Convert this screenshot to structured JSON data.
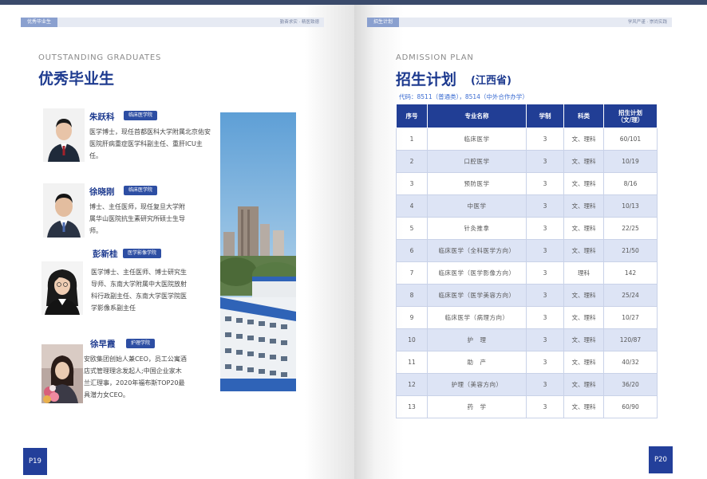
{
  "left": {
    "header_tag": "优秀毕业生",
    "header_right": "勤奋求实 · 精医致德",
    "title_en": "OUTSTANDING GRADUATES",
    "title_cn": "优秀毕业生",
    "page_number": "P19",
    "graduates": [
      {
        "name": "朱跃科",
        "college": "临床医学院",
        "description": "医学博士，现任首都医科大学附属北京佑安医院肝病重症医学科副主任、重肝ICU主任。"
      },
      {
        "name": "徐晓刚",
        "college": "临床医学院",
        "description": "博士、主任医师，现任复旦大学附属华山医院抗生素研究所硕士生导师。"
      },
      {
        "name": "彭新桂",
        "college": "医学影像学院",
        "description": "医学博士、主任医师、博士研究生导师、东南大学附属中大医院放射科行政副主任、东南大学医学院医学影像系副主任"
      },
      {
        "name": "徐早霞",
        "college": "护理学院",
        "description": "安欧集团创始人兼CEO，员工公寓酒店式管理理念发起人;中国企业家木兰汇理事，2020年福布斯TOP20最具潜力女CEO。"
      }
    ]
  },
  "right": {
    "header_tag": "招生计划",
    "header_right": "学风严谨 · 崇尚实践",
    "title_en": "ADMISSION PLAN",
    "title_cn": "招生计划",
    "province": "(江西省)",
    "code_line": "代码：8511（普通类），8514（中外合作办学）",
    "page_number": "P20",
    "table": {
      "headers": [
        "序号",
        "专业名称",
        "学制",
        "科类",
        "招生计划\n（文/理）"
      ],
      "rows": [
        [
          "1",
          "临床医学",
          "3",
          "文、理科",
          "60/101"
        ],
        [
          "2",
          "口腔医学",
          "3",
          "文、理科",
          "10/19"
        ],
        [
          "3",
          "预防医学",
          "3",
          "文、理科",
          "8/16"
        ],
        [
          "4",
          "中医学",
          "3",
          "文、理科",
          "10/13"
        ],
        [
          "5",
          "针灸推拿",
          "3",
          "文、理科",
          "22/25"
        ],
        [
          "6",
          "临床医学（全科医学方向）",
          "3",
          "文、理科",
          "21/50"
        ],
        [
          "7",
          "临床医学（医学影像方向）",
          "3",
          "理科",
          "142"
        ],
        [
          "8",
          "临床医学（医学美容方向）",
          "3",
          "文、理科",
          "25/24"
        ],
        [
          "9",
          "临床医学（病理方向）",
          "3",
          "文、理科",
          "10/27"
        ],
        [
          "10",
          "护　理",
          "3",
          "文、理科",
          "120/87"
        ],
        [
          "11",
          "助　产",
          "3",
          "文、理科",
          "40/32"
        ],
        [
          "12",
          "护理（美容方向）",
          "3",
          "文、理科",
          "36/20"
        ],
        [
          "13",
          "药　学",
          "3",
          "文、理科",
          "60/90"
        ]
      ]
    }
  },
  "colors": {
    "brand": "#1d3a8f",
    "table_header": "#213e95",
    "row_alt": "#dde4f5",
    "badge": "#2d4ea3"
  }
}
